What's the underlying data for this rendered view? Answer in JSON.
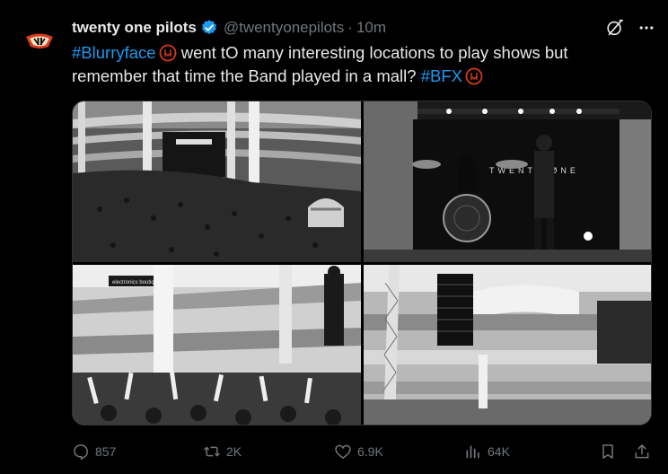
{
  "author": {
    "display_name": "twenty one pilots",
    "handle": "@twentyonepilots",
    "separator": "·",
    "time": "10m",
    "verified_icon": "verified-badge-icon",
    "avatar": "band-logo-avatar"
  },
  "tweet": {
    "hashtag1": "#Blurryface",
    "text_part1": "went tO many interesting locations to play shows but remember that time the Band played in a mall?",
    "hashtag2": "#BFX",
    "hashflag_icon": "blurryface-hashflag-icon"
  },
  "media": {
    "photos": [
      "crowd-in-mall-photo",
      "drummer-and-singer-on-stage-photo",
      "singer-on-balcony-photo",
      "speaker-array-in-mall-photo"
    ],
    "band_sign_text": "TWENTY ØNE",
    "store_sign": "electronics boutique"
  },
  "actions": {
    "replies": "857",
    "reposts": "2K",
    "likes": "6.9K",
    "views": "64K"
  },
  "colors": {
    "background": "#000000",
    "text": "#e7e9ea",
    "muted": "#71767b",
    "link": "#1d9bf0",
    "verified": "#1d9bf0"
  }
}
